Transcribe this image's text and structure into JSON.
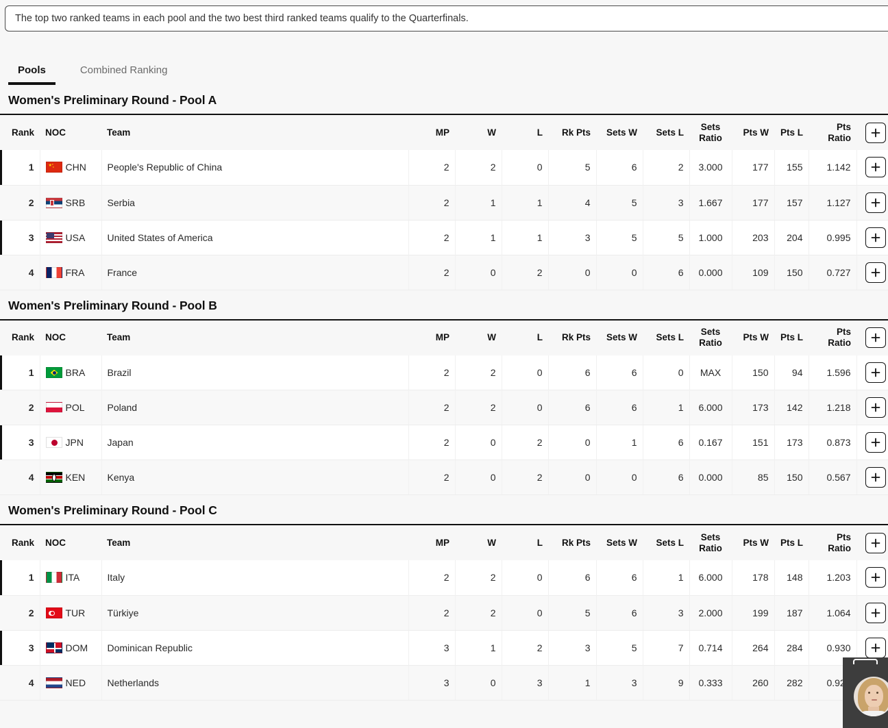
{
  "notice": {
    "text": "The top two ranked teams in each pool and the two best third ranked teams qualify to the Quarterfinals."
  },
  "tabs": [
    {
      "label": "Pools",
      "active": true
    },
    {
      "label": "Combined Ranking",
      "active": false
    }
  ],
  "columns": {
    "rank": "Rank",
    "noc": "NOC",
    "team": "Team",
    "mp": "MP",
    "w": "W",
    "l": "L",
    "rk_pts": "Rk Pts",
    "sets_w": "Sets W",
    "sets_l": "Sets L",
    "sets_ratio_line1": "Sets",
    "sets_ratio_line2": "Ratio",
    "pts_w": "Pts W",
    "pts_l": "Pts L",
    "pts_ratio": "Pts Ratio",
    "action": "+"
  },
  "action_button": {
    "label": "+",
    "name": "expand-row-button"
  },
  "colors": {
    "accent": "#111111",
    "page_bg": "#f7f7f7",
    "row_odd": "#ffffff",
    "row_even": "#f8f8f8"
  },
  "pools": [
    {
      "title": "Women's Preliminary Round - Pool A",
      "rows": [
        {
          "rank": "1",
          "noc": "CHN",
          "flag": "flag-chn",
          "team": "People's Republic of China",
          "mp": "2",
          "w": "2",
          "l": "0",
          "rk_pts": "5",
          "sets_w": "6",
          "sets_l": "2",
          "sets_ratio": "3.000",
          "pts_w": "177",
          "pts_l": "155",
          "pts_ratio": "1.142"
        },
        {
          "rank": "2",
          "noc": "SRB",
          "flag": "flag-srb",
          "team": "Serbia",
          "mp": "2",
          "w": "1",
          "l": "1",
          "rk_pts": "4",
          "sets_w": "5",
          "sets_l": "3",
          "sets_ratio": "1.667",
          "pts_w": "177",
          "pts_l": "157",
          "pts_ratio": "1.127"
        },
        {
          "rank": "3",
          "noc": "USA",
          "flag": "flag-usa",
          "team": "United States of America",
          "mp": "2",
          "w": "1",
          "l": "1",
          "rk_pts": "3",
          "sets_w": "5",
          "sets_l": "5",
          "sets_ratio": "1.000",
          "pts_w": "203",
          "pts_l": "204",
          "pts_ratio": "0.995"
        },
        {
          "rank": "4",
          "noc": "FRA",
          "flag": "flag-fra",
          "team": "France",
          "mp": "2",
          "w": "0",
          "l": "2",
          "rk_pts": "0",
          "sets_w": "0",
          "sets_l": "6",
          "sets_ratio": "0.000",
          "pts_w": "109",
          "pts_l": "150",
          "pts_ratio": "0.727"
        }
      ]
    },
    {
      "title": "Women's Preliminary Round - Pool B",
      "rows": [
        {
          "rank": "1",
          "noc": "BRA",
          "flag": "flag-bra",
          "team": "Brazil",
          "mp": "2",
          "w": "2",
          "l": "0",
          "rk_pts": "6",
          "sets_w": "6",
          "sets_l": "0",
          "sets_ratio": "MAX",
          "pts_w": "150",
          "pts_l": "94",
          "pts_ratio": "1.596"
        },
        {
          "rank": "2",
          "noc": "POL",
          "flag": "flag-pol",
          "team": "Poland",
          "mp": "2",
          "w": "2",
          "l": "0",
          "rk_pts": "6",
          "sets_w": "6",
          "sets_l": "1",
          "sets_ratio": "6.000",
          "pts_w": "173",
          "pts_l": "142",
          "pts_ratio": "1.218"
        },
        {
          "rank": "3",
          "noc": "JPN",
          "flag": "flag-jpn",
          "team": "Japan",
          "mp": "2",
          "w": "0",
          "l": "2",
          "rk_pts": "0",
          "sets_w": "1",
          "sets_l": "6",
          "sets_ratio": "0.167",
          "pts_w": "151",
          "pts_l": "173",
          "pts_ratio": "0.873"
        },
        {
          "rank": "4",
          "noc": "KEN",
          "flag": "flag-ken",
          "team": "Kenya",
          "mp": "2",
          "w": "0",
          "l": "2",
          "rk_pts": "0",
          "sets_w": "0",
          "sets_l": "6",
          "sets_ratio": "0.000",
          "pts_w": "85",
          "pts_l": "150",
          "pts_ratio": "0.567"
        }
      ]
    },
    {
      "title": "Women's Preliminary Round - Pool C",
      "rows": [
        {
          "rank": "1",
          "noc": "ITA",
          "flag": "flag-ita",
          "team": "Italy",
          "mp": "2",
          "w": "2",
          "l": "0",
          "rk_pts": "6",
          "sets_w": "6",
          "sets_l": "1",
          "sets_ratio": "6.000",
          "pts_w": "178",
          "pts_l": "148",
          "pts_ratio": "1.203"
        },
        {
          "rank": "2",
          "noc": "TUR",
          "flag": "flag-tur",
          "team": "Türkiye",
          "mp": "2",
          "w": "2",
          "l": "0",
          "rk_pts": "5",
          "sets_w": "6",
          "sets_l": "3",
          "sets_ratio": "2.000",
          "pts_w": "199",
          "pts_l": "187",
          "pts_ratio": "1.064"
        },
        {
          "rank": "3",
          "noc": "DOM",
          "flag": "flag-dom",
          "team": "Dominican Republic",
          "mp": "3",
          "w": "1",
          "l": "2",
          "rk_pts": "3",
          "sets_w": "5",
          "sets_l": "7",
          "sets_ratio": "0.714",
          "pts_w": "264",
          "pts_l": "284",
          "pts_ratio": "0.930"
        },
        {
          "rank": "4",
          "noc": "NED",
          "flag": "flag-ned",
          "team": "Netherlands",
          "mp": "3",
          "w": "0",
          "l": "3",
          "rk_pts": "1",
          "sets_w": "3",
          "sets_l": "9",
          "sets_ratio": "0.333",
          "pts_w": "260",
          "pts_l": "282",
          "pts_ratio": "0.922"
        }
      ]
    }
  ],
  "video_widget": {
    "name": "video-call-avatar",
    "visible": true
  }
}
